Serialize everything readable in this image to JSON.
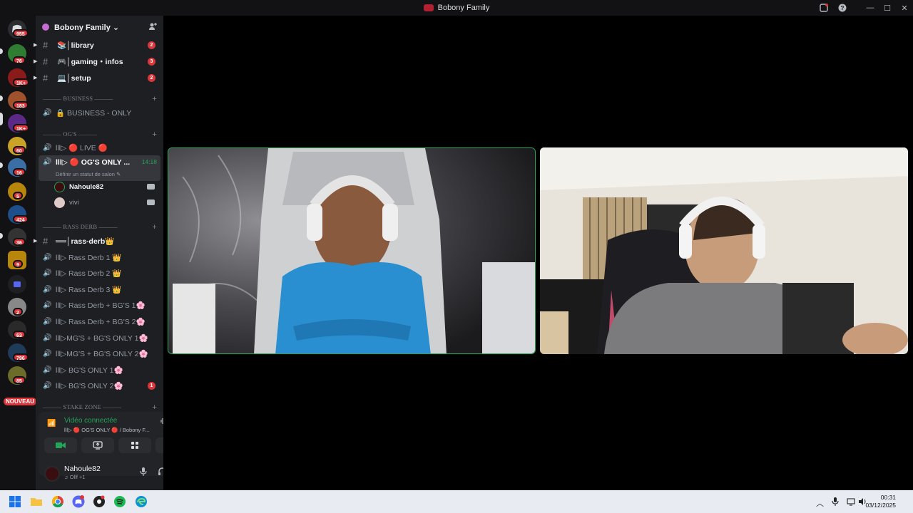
{
  "window": {
    "title": "Bobony Family"
  },
  "servers": {
    "badges": [
      "955",
      "76",
      "1K+",
      "183",
      "1K+",
      "60",
      "16",
      "5",
      "424",
      "36",
      "9",
      "2",
      "63",
      "796",
      "85"
    ],
    "new_label": "NOUVEAU"
  },
  "guild": {
    "name": "Bobony Family ⌄"
  },
  "channels": {
    "text": [
      {
        "name": "📚│library",
        "badge": "2"
      },
      {
        "name": "🎮│gaming・infos",
        "badge": "3"
      },
      {
        "name": "💻│setup",
        "badge": "2"
      }
    ],
    "categories": {
      "business": "——— BUSINESS ———",
      "ogs": "——— OG'S ———",
      "rass": "——— RASS DERB ———",
      "stake": "——— STAKE ZONE ———"
    },
    "business_voice": "🔒 BUSINESS - ONLY",
    "og_live": "lll▷ 🔴 LIVE 🔴",
    "og_active": {
      "name": "lll▷ 🔴 OG'S ONLY ...",
      "time": "14:18",
      "status": "Définir un statut de salon ✎"
    },
    "voice_users": [
      "Nahoule82",
      "vivi"
    ],
    "rass_text": "══│rass-derb👑",
    "rass_voice": [
      "lll▷ Rass Derb 1 👑",
      "lll▷ Rass Derb 2 👑",
      "lll▷ Rass Derb 3 👑",
      "lll▷ Rass Derb + BG'S 1🌸",
      "lll▷ Rass Derb + BG'S 2🌸",
      "lll▷MG'S + BG'S ONLY 1🌸",
      "lll▷MG'S + BG'S ONLY 2🌸",
      "lll▷ BG'S ONLY 1🌸",
      "lll▷ BG'S ONLY 2🌸"
    ],
    "bgs2_badge": "1"
  },
  "voice_panel": {
    "status": "Vidéo connectée",
    "location": "lll▷ 🔴 OG'S ONLY 🔴 / Bobony F..."
  },
  "user": {
    "name": "Nahoule82",
    "activity": "♫ Ollf +1"
  },
  "clock": {
    "time": "00:31",
    "date": "03/12/2025"
  }
}
